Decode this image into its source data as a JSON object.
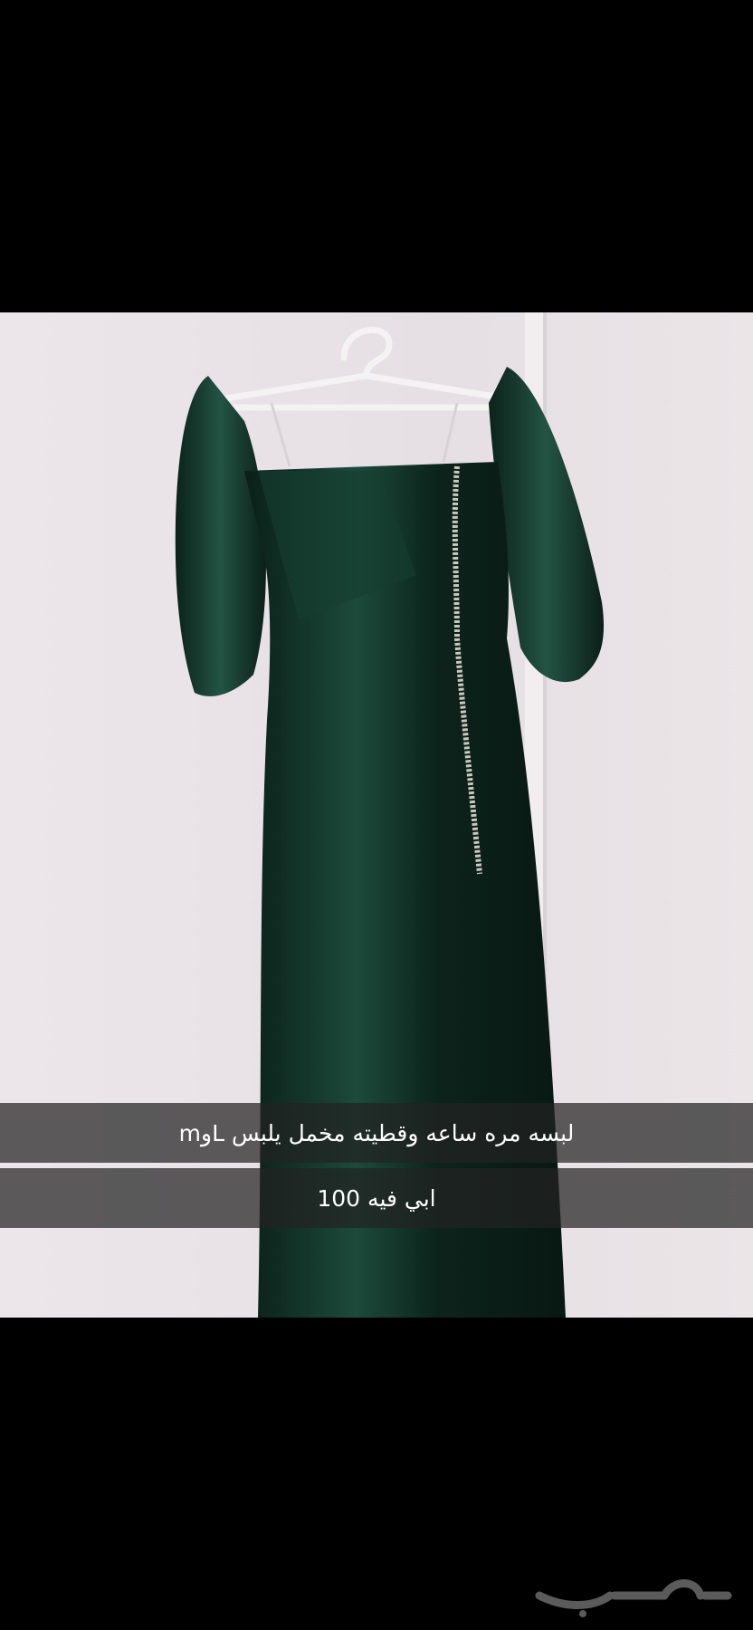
{
  "post": {
    "caption_line_1": "لبسه مره ساعه وقطيته مخمل يلبس Lوm",
    "caption_line_2": "ابي فيه 100"
  },
  "photo": {
    "subject": "green velvet off-shoulder dress on hanger",
    "dress_color": "#0f2a22",
    "wall_color": "#e9e2e6"
  },
  "watermark": {
    "brand": "حراج"
  }
}
